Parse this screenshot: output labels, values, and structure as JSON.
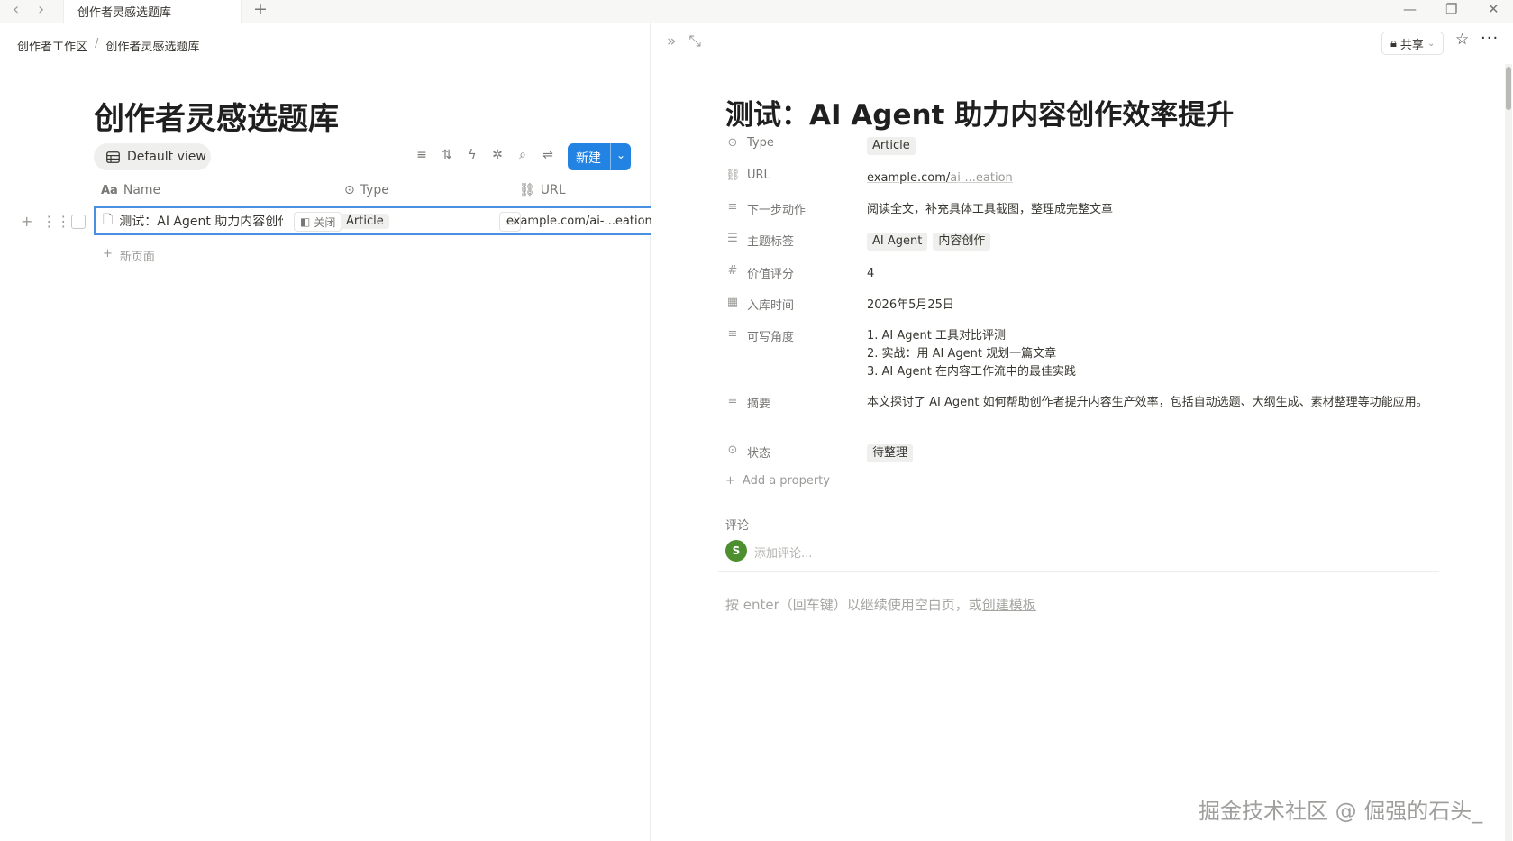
{
  "titlebar": {
    "tab_title": "创作者灵感选题库",
    "back_icon": "‹",
    "forward_icon": "›",
    "new_tab_icon": "+",
    "minimize_icon": "—",
    "restore_icon": "❐",
    "close_icon": "✕"
  },
  "left": {
    "breadcrumb": [
      "创作者工作区",
      "创作者灵感选题库"
    ],
    "breadcrumb_sep": "/",
    "db_title": "创作者灵感选题库",
    "view_label": "Default view",
    "new_button": "新建",
    "columns": {
      "name": "Name",
      "type": "Type",
      "url": "URL"
    },
    "row": {
      "name": "测试：AI Agent 助力内容创作效率提升",
      "open_label": "关闭",
      "type": "Article",
      "url": "example.com/ai-...eation"
    },
    "new_page_label": "新页面"
  },
  "right": {
    "share_label": "共享",
    "title": "测试：AI Agent 助力内容创作效率提升",
    "properties": {
      "type": {
        "name": "Type",
        "value": "Article"
      },
      "url": {
        "name": "URL",
        "value_main": "example.com/",
        "value_dim": "ai-...eation"
      },
      "next_action": {
        "name": "下一步动作",
        "value": "阅读全文，补充具体工具截图，整理成完整文章"
      },
      "topic_tags": {
        "name": "主题标签",
        "tags": [
          "AI Agent",
          "内容创作"
        ]
      },
      "score": {
        "name": "价值评分",
        "value": "4"
      },
      "date_added": {
        "name": "入库时间",
        "value": "2026年5月25日"
      },
      "angles": {
        "name": "可写角度",
        "lines": [
          "1. AI Agent 工具对比评测",
          "2. 实战：用 AI Agent 规划一篇文章",
          "3. AI Agent 在内容工作流中的最佳实践"
        ]
      },
      "summary": {
        "name": "摘要",
        "value": "本文探讨了 AI Agent 如何帮助创作者提升内容生产效率，包括自动选题、大纲生成、素材整理等功能应用。"
      },
      "status": {
        "name": "状态",
        "value": "待整理"
      }
    },
    "add_property": "Add a property",
    "comments_label": "评论",
    "avatar_letter": "S",
    "comment_placeholder": "添加评论...",
    "hint_text": "按 enter（回车键）以继续使用空白页，或",
    "hint_link": "创建模板"
  },
  "watermark": "掘金技术社区 @ 倔强的石头_",
  "colors": {
    "accent": "#2383e2",
    "selection_border": "#4a90e2",
    "avatar": "#4d8f2f",
    "tag_bg": "#efefed"
  }
}
